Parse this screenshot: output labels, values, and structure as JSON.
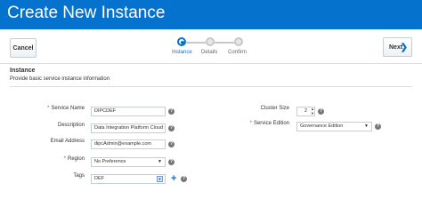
{
  "header": {
    "title": "Create New Instance"
  },
  "toolbar": {
    "cancel_label": "Cancel",
    "next_label": "Next",
    "next_icon": "chevron-right-icon"
  },
  "train": {
    "steps": [
      {
        "label": "Instance",
        "active": true
      },
      {
        "label": "Details",
        "active": false
      },
      {
        "label": "Confirm",
        "active": false
      }
    ]
  },
  "section": {
    "title": "Instance",
    "description": "Provide basic service instance information"
  },
  "form": {
    "required_marker": "*",
    "help_glyph": "?",
    "service_name": {
      "label": "Service Name",
      "value": "DIPCDEF",
      "required": true
    },
    "description": {
      "label": "Description",
      "value": "Data Integration Platform Cloud f"
    },
    "email": {
      "label": "Email Address",
      "value": "dipcAdmin@example.com"
    },
    "region": {
      "label": "Region",
      "value": "No Preference",
      "required": true
    },
    "tags": {
      "label": "Tags",
      "value": "DEF"
    },
    "cluster_size": {
      "label": "Cluster Size",
      "value": "2"
    },
    "service_edition": {
      "label": "Service Edition",
      "value": "Governance Edition",
      "required": true
    }
  },
  "colors": {
    "header_bg": "#0572ce",
    "accent": "#0572ce",
    "required": "#c74634"
  }
}
